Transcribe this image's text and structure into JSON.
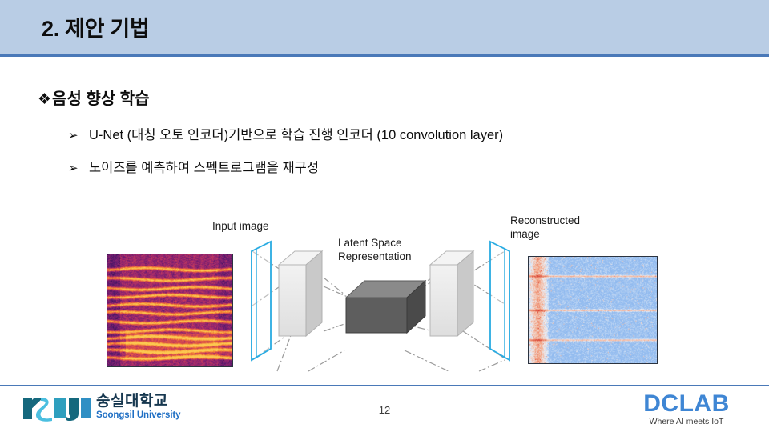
{
  "slide": {
    "page_number": "12",
    "header": {
      "title": "2. 제안 기법",
      "band_color": "#b9cde5",
      "rule_color": "#4a79b8"
    },
    "content": {
      "heading": {
        "marker": "❖",
        "text": "음성 향상 학습"
      },
      "bullets": [
        {
          "marker": "➢",
          "text": "U-Net (대칭 오토 인코더)기반으로 학습 진행 인코더 (10 convolution layer)"
        },
        {
          "marker": "➢",
          "text": "노이즈를 예측하여 스펙트로그램을 재구성"
        }
      ]
    },
    "diagram": {
      "labels": {
        "input": "Input image",
        "latent_line1": "Latent Space",
        "latent_line2": "Representation",
        "reconstructed_line1": "Reconstructed",
        "reconstructed_line2": "image"
      },
      "colors": {
        "wireframe": "#29abe2",
        "slab_light": "#e8e8e8",
        "slab_mid": "#d2d2d2",
        "slab_dark": "#bdbdbd",
        "latent_top": "#8a8a8a",
        "latent_front": "#5e5e5e",
        "latent_side": "#4a4a4a",
        "connector": "#9a9a9a"
      },
      "input_image_alt": "magenta-orange spectrogram",
      "reconstructed_image_alt": "blue-red reconstructed spectrogram"
    },
    "footer": {
      "rule_color": "#4a79b8",
      "soongsil": {
        "korean": "숭실대학교",
        "english": "Soongsil University",
        "mark_colors": [
          "#15687d",
          "#4bbfe0",
          "#2e9fbe",
          "#15687d",
          "#2f8fc4"
        ]
      },
      "dclab": {
        "name": "DCLAB",
        "tagline": "Where AI meets IoT",
        "color": "#3f86d4"
      }
    }
  }
}
